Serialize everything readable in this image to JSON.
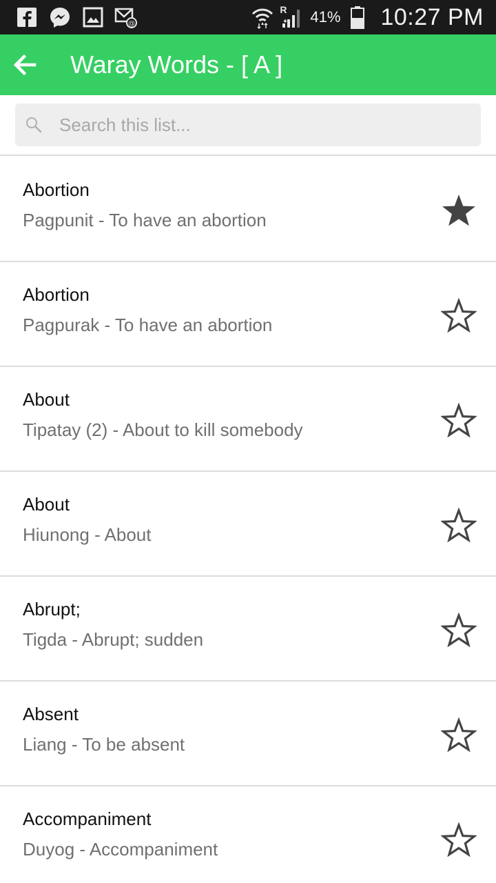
{
  "status_bar": {
    "icons": [
      "facebook-icon",
      "messenger-icon",
      "gallery-icon",
      "email-icon",
      "wifi-icon",
      "signal-icon",
      "battery-icon"
    ],
    "roaming_label": "R",
    "battery_percent": "41%",
    "time": "10:27 PM"
  },
  "app_bar": {
    "title": "Waray Words - [ A ]",
    "accent_color": "#36cf63"
  },
  "search": {
    "placeholder": "Search this list...",
    "value": ""
  },
  "words": [
    {
      "word": "Abortion",
      "translation": "Pagpunit - To have an abortion",
      "favorite": true
    },
    {
      "word": "Abortion",
      "translation": "Pagpurak - To have an abortion",
      "favorite": false
    },
    {
      "word": "About",
      "translation": "Tipatay (2) - About to kill somebody",
      "favorite": false
    },
    {
      "word": "About",
      "translation": "Hiunong - About",
      "favorite": false
    },
    {
      "word": "Abrupt;",
      "translation": "Tigda - Abrupt; sudden",
      "favorite": false
    },
    {
      "word": "Absent",
      "translation": "Liang - To be absent",
      "favorite": false
    },
    {
      "word": "Accompaniment",
      "translation": "Duyog - Accompaniment",
      "favorite": false
    }
  ]
}
